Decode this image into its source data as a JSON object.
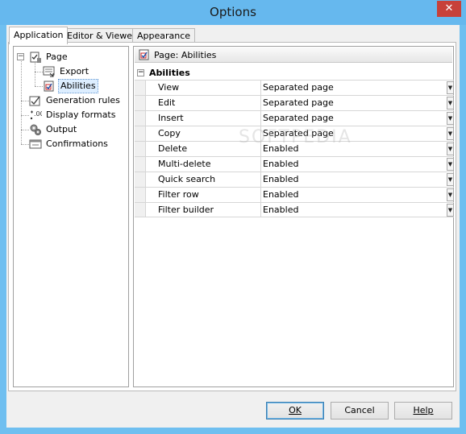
{
  "window": {
    "title": "Options",
    "close_glyph": "✕"
  },
  "tabs": [
    {
      "label": "Application",
      "active": true
    },
    {
      "label": "Editor & Viewers",
      "active": false
    },
    {
      "label": "Appearance",
      "active": false
    }
  ],
  "tree": {
    "items": [
      {
        "label": "Page",
        "icon": "page-icon",
        "expanded": true
      },
      {
        "label": "Export",
        "icon": "export-icon"
      },
      {
        "label": "Abilities",
        "icon": "abilities-icon",
        "selected": true
      },
      {
        "label": "Generation rules",
        "icon": "generation-rules-icon"
      },
      {
        "label": "Display formats",
        "icon": "display-formats-icon"
      },
      {
        "label": "Output",
        "icon": "output-icon"
      },
      {
        "label": "Confirmations",
        "icon": "confirmations-icon"
      }
    ],
    "expander_glyph": "−"
  },
  "pane": {
    "header": "Page: Abilities",
    "group": "Abilities",
    "rows": [
      {
        "name": "View",
        "value": "Separated page"
      },
      {
        "name": "Edit",
        "value": "Separated page"
      },
      {
        "name": "Insert",
        "value": "Separated page"
      },
      {
        "name": "Copy",
        "value": "Separated page"
      },
      {
        "name": "Delete",
        "value": "Enabled"
      },
      {
        "name": "Multi-delete",
        "value": "Enabled"
      },
      {
        "name": "Quick search",
        "value": "Enabled"
      },
      {
        "name": "Filter row",
        "value": "Enabled"
      },
      {
        "name": "Filter builder",
        "value": "Enabled"
      }
    ],
    "dropdown_glyph": "▼"
  },
  "buttons": {
    "ok": "OK",
    "cancel": "Cancel",
    "help": "Help"
  },
  "watermark": "SOFTPEDIA",
  "colors": {
    "titlebar": "#66b8ee",
    "close": "#c7413a",
    "selection": "#ddeeff"
  }
}
